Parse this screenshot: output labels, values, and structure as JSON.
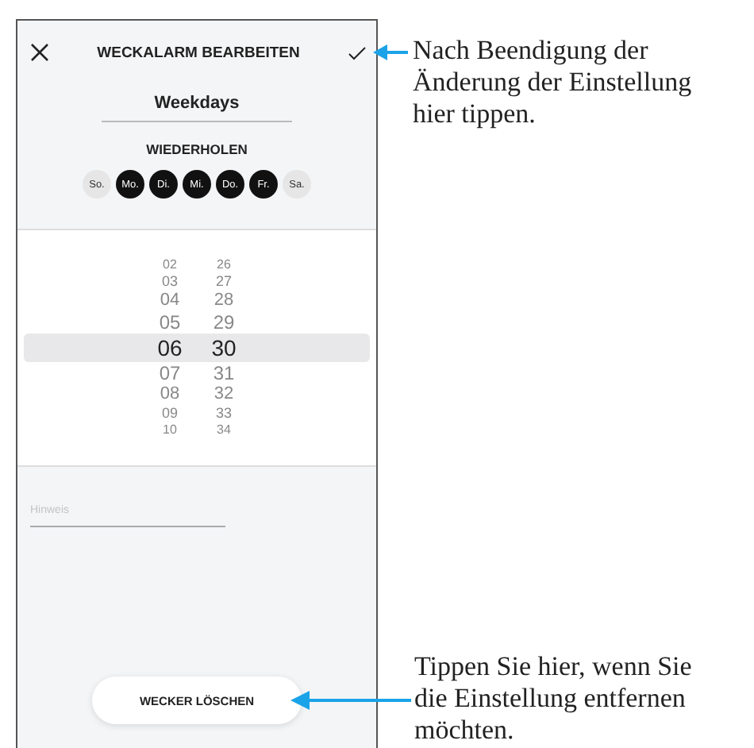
{
  "header": {
    "title": "WECKALARM BEARBEITEN"
  },
  "name_field": {
    "value": "Weekdays"
  },
  "repeat": {
    "label": "WIEDERHOLEN",
    "days": [
      {
        "label": "So.",
        "selected": false
      },
      {
        "label": "Mo.",
        "selected": true
      },
      {
        "label": "Di.",
        "selected": true
      },
      {
        "label": "Mi.",
        "selected": true
      },
      {
        "label": "Do.",
        "selected": true
      },
      {
        "label": "Fr.",
        "selected": true
      },
      {
        "label": "Sa.",
        "selected": false
      }
    ]
  },
  "time_picker": {
    "rows": [
      {
        "hour": "02",
        "minute": "26",
        "selected": false
      },
      {
        "hour": "03",
        "minute": "27",
        "selected": false
      },
      {
        "hour": "04",
        "minute": "28",
        "selected": false
      },
      {
        "hour": "05",
        "minute": "29",
        "selected": false
      },
      {
        "hour": "06",
        "minute": "30",
        "selected": true
      },
      {
        "hour": "07",
        "minute": "31",
        "selected": false
      },
      {
        "hour": "08",
        "minute": "32",
        "selected": false
      },
      {
        "hour": "09",
        "minute": "33",
        "selected": false
      },
      {
        "hour": "10",
        "minute": "34",
        "selected": false
      }
    ]
  },
  "note_field": {
    "placeholder": "Hinweis"
  },
  "delete_button": {
    "label": "WECKER LÖSCHEN"
  },
  "annotations": [
    {
      "text": "Nach Beendigung der Änderung der Einstellung hier tippen."
    },
    {
      "text": "Tippen Sie hier, wenn Sie die Einstellung entfernen möchten."
    }
  ]
}
